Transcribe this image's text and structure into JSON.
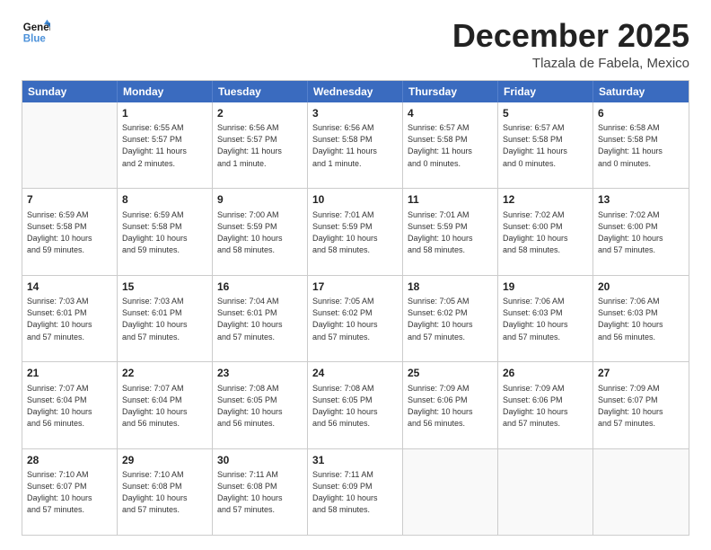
{
  "header": {
    "logo_line1": "General",
    "logo_line2": "Blue",
    "month_title": "December 2025",
    "location": "Tlazala de Fabela, Mexico"
  },
  "day_names": [
    "Sunday",
    "Monday",
    "Tuesday",
    "Wednesday",
    "Thursday",
    "Friday",
    "Saturday"
  ],
  "weeks": [
    [
      {
        "day": "",
        "info": ""
      },
      {
        "day": "1",
        "info": "Sunrise: 6:55 AM\nSunset: 5:57 PM\nDaylight: 11 hours\nand 2 minutes."
      },
      {
        "day": "2",
        "info": "Sunrise: 6:56 AM\nSunset: 5:57 PM\nDaylight: 11 hours\nand 1 minute."
      },
      {
        "day": "3",
        "info": "Sunrise: 6:56 AM\nSunset: 5:58 PM\nDaylight: 11 hours\nand 1 minute."
      },
      {
        "day": "4",
        "info": "Sunrise: 6:57 AM\nSunset: 5:58 PM\nDaylight: 11 hours\nand 0 minutes."
      },
      {
        "day": "5",
        "info": "Sunrise: 6:57 AM\nSunset: 5:58 PM\nDaylight: 11 hours\nand 0 minutes."
      },
      {
        "day": "6",
        "info": "Sunrise: 6:58 AM\nSunset: 5:58 PM\nDaylight: 11 hours\nand 0 minutes."
      }
    ],
    [
      {
        "day": "7",
        "info": "Sunrise: 6:59 AM\nSunset: 5:58 PM\nDaylight: 10 hours\nand 59 minutes."
      },
      {
        "day": "8",
        "info": "Sunrise: 6:59 AM\nSunset: 5:58 PM\nDaylight: 10 hours\nand 59 minutes."
      },
      {
        "day": "9",
        "info": "Sunrise: 7:00 AM\nSunset: 5:59 PM\nDaylight: 10 hours\nand 58 minutes."
      },
      {
        "day": "10",
        "info": "Sunrise: 7:01 AM\nSunset: 5:59 PM\nDaylight: 10 hours\nand 58 minutes."
      },
      {
        "day": "11",
        "info": "Sunrise: 7:01 AM\nSunset: 5:59 PM\nDaylight: 10 hours\nand 58 minutes."
      },
      {
        "day": "12",
        "info": "Sunrise: 7:02 AM\nSunset: 6:00 PM\nDaylight: 10 hours\nand 58 minutes."
      },
      {
        "day": "13",
        "info": "Sunrise: 7:02 AM\nSunset: 6:00 PM\nDaylight: 10 hours\nand 57 minutes."
      }
    ],
    [
      {
        "day": "14",
        "info": "Sunrise: 7:03 AM\nSunset: 6:01 PM\nDaylight: 10 hours\nand 57 minutes."
      },
      {
        "day": "15",
        "info": "Sunrise: 7:03 AM\nSunset: 6:01 PM\nDaylight: 10 hours\nand 57 minutes."
      },
      {
        "day": "16",
        "info": "Sunrise: 7:04 AM\nSunset: 6:01 PM\nDaylight: 10 hours\nand 57 minutes."
      },
      {
        "day": "17",
        "info": "Sunrise: 7:05 AM\nSunset: 6:02 PM\nDaylight: 10 hours\nand 57 minutes."
      },
      {
        "day": "18",
        "info": "Sunrise: 7:05 AM\nSunset: 6:02 PM\nDaylight: 10 hours\nand 57 minutes."
      },
      {
        "day": "19",
        "info": "Sunrise: 7:06 AM\nSunset: 6:03 PM\nDaylight: 10 hours\nand 57 minutes."
      },
      {
        "day": "20",
        "info": "Sunrise: 7:06 AM\nSunset: 6:03 PM\nDaylight: 10 hours\nand 56 minutes."
      }
    ],
    [
      {
        "day": "21",
        "info": "Sunrise: 7:07 AM\nSunset: 6:04 PM\nDaylight: 10 hours\nand 56 minutes."
      },
      {
        "day": "22",
        "info": "Sunrise: 7:07 AM\nSunset: 6:04 PM\nDaylight: 10 hours\nand 56 minutes."
      },
      {
        "day": "23",
        "info": "Sunrise: 7:08 AM\nSunset: 6:05 PM\nDaylight: 10 hours\nand 56 minutes."
      },
      {
        "day": "24",
        "info": "Sunrise: 7:08 AM\nSunset: 6:05 PM\nDaylight: 10 hours\nand 56 minutes."
      },
      {
        "day": "25",
        "info": "Sunrise: 7:09 AM\nSunset: 6:06 PM\nDaylight: 10 hours\nand 56 minutes."
      },
      {
        "day": "26",
        "info": "Sunrise: 7:09 AM\nSunset: 6:06 PM\nDaylight: 10 hours\nand 57 minutes."
      },
      {
        "day": "27",
        "info": "Sunrise: 7:09 AM\nSunset: 6:07 PM\nDaylight: 10 hours\nand 57 minutes."
      }
    ],
    [
      {
        "day": "28",
        "info": "Sunrise: 7:10 AM\nSunset: 6:07 PM\nDaylight: 10 hours\nand 57 minutes."
      },
      {
        "day": "29",
        "info": "Sunrise: 7:10 AM\nSunset: 6:08 PM\nDaylight: 10 hours\nand 57 minutes."
      },
      {
        "day": "30",
        "info": "Sunrise: 7:11 AM\nSunset: 6:08 PM\nDaylight: 10 hours\nand 57 minutes."
      },
      {
        "day": "31",
        "info": "Sunrise: 7:11 AM\nSunset: 6:09 PM\nDaylight: 10 hours\nand 58 minutes."
      },
      {
        "day": "",
        "info": ""
      },
      {
        "day": "",
        "info": ""
      },
      {
        "day": "",
        "info": ""
      }
    ]
  ]
}
